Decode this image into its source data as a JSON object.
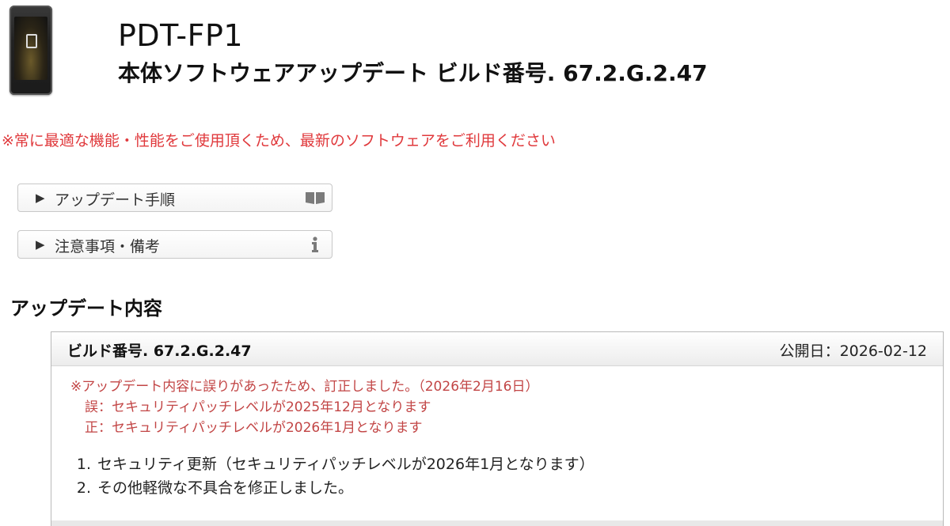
{
  "header": {
    "product_name": "PDT-FP1",
    "update_title": "本体ソフトウェアアップデート ビルド番号. 67.2.G.2.47",
    "device_image": "phone-image"
  },
  "notice": "※常に最適な機能・性能をご使用頂くため、最新のソフトウェアをご利用ください",
  "folds": [
    {
      "arrow": "▶",
      "label": "アップデート手順",
      "icon": "book-icon"
    },
    {
      "arrow": "▶",
      "label": "注意事項・備考",
      "icon": "info-icon"
    }
  ],
  "content": {
    "heading": "アップデート内容",
    "build_number": "ビルド番号. 67.2.G.2.47",
    "publish_date_label": "公開日",
    "publish_date_sep": "：",
    "publish_date": "2026-02-12",
    "errata": {
      "line1": "※アップデート内容に誤りがあったため、訂正しました。（2026年2月16日）",
      "line2": "誤：セキュリティパッチレベルが2025年12月となります",
      "line3": "正：セキュリティパッチレベルが2026年1月となります"
    },
    "changes": [
      {
        "num": "1.",
        "text": "セキュリティ更新（セキュリティパッチレベルが2026年1月となります）"
      },
      {
        "num": "2.",
        "text": "その他軽微な不具合を修正しました。"
      }
    ]
  },
  "colors": {
    "notice_red": "#e0393c",
    "errata_red": "#c24545",
    "border": "#c8c8c8"
  }
}
